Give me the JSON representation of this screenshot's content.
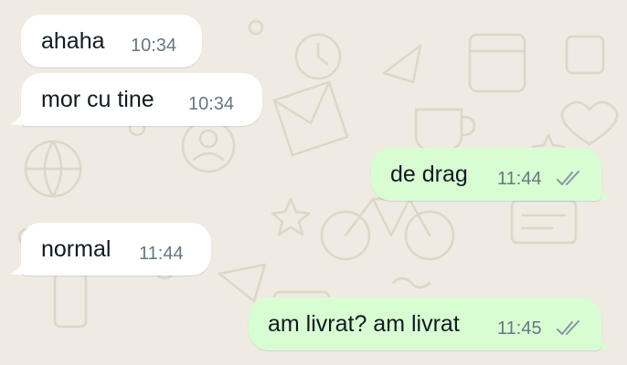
{
  "colors": {
    "background": "#efeae2",
    "incoming_bubble": "#ffffff",
    "outgoing_bubble": "#d9fdd3",
    "text": "#111b21",
    "timestamp": "#667781",
    "read_ticks": "#8696a0"
  },
  "messages": [
    {
      "direction": "incoming",
      "text": "ahaha",
      "time": "10:34"
    },
    {
      "direction": "incoming",
      "text": "mor cu tine",
      "time": "10:34"
    },
    {
      "direction": "outgoing",
      "text": "de drag",
      "time": "11:44",
      "status_icon": "double-check-icon"
    },
    {
      "direction": "incoming",
      "text": "normal",
      "time": "11:44"
    },
    {
      "direction": "outgoing",
      "text": "am livrat? am livrat",
      "time": "11:45",
      "status_icon": "double-check-icon"
    }
  ]
}
